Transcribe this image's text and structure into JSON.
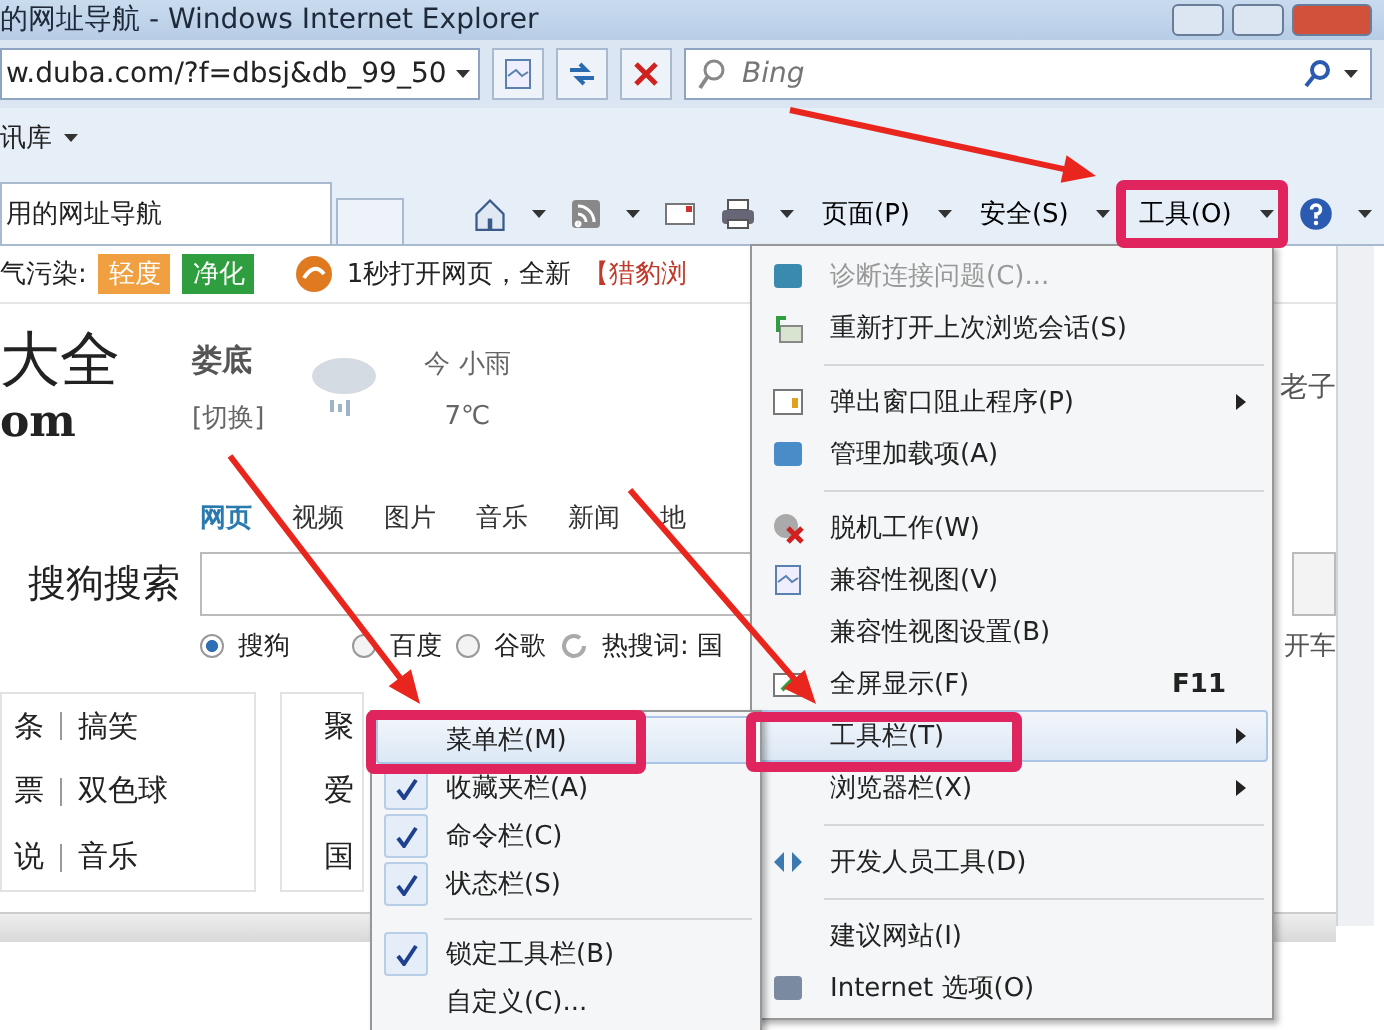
{
  "window": {
    "title": "的网址导航 - Windows Internet Explorer"
  },
  "address_bar": {
    "value": "w.duba.com/?f=dbsj&db_99_50"
  },
  "search_box": {
    "placeholder": "Bing"
  },
  "favorites_bar": {
    "label": "讯库"
  },
  "tab": {
    "label": "用的网址导航"
  },
  "command_bar": {
    "items": [
      {
        "kind": "home"
      },
      {
        "kind": "feed"
      },
      {
        "kind": "mail"
      },
      {
        "kind": "print"
      },
      {
        "kind": "text",
        "label": "页面(P)"
      },
      {
        "kind": "text",
        "label": "安全(S)"
      },
      {
        "kind": "text",
        "label": "工具(O)"
      },
      {
        "kind": "help"
      }
    ]
  },
  "page": {
    "notice": {
      "label": "气污染:",
      "badges": [
        {
          "label": "轻度",
          "color": "#f0a040"
        },
        {
          "label": "净化",
          "color": "#2e9e3e"
        }
      ],
      "promo": "1秒打开网页，全新",
      "promo_link": "【猎豹浏"
    },
    "logo": {
      "line1": "大全",
      "line2": "om"
    },
    "city": {
      "name": "娄底",
      "switch": "[切换]"
    },
    "weather": {
      "today": "今 小雨",
      "temp": "7℃"
    },
    "right_text": "老子",
    "search_tabs": [
      {
        "label": "网页",
        "selected": true
      },
      {
        "label": "视频",
        "selected": false
      },
      {
        "label": "图片",
        "selected": false
      },
      {
        "label": "音乐",
        "selected": false
      },
      {
        "label": "新闻",
        "selected": false
      },
      {
        "label": "地",
        "selected": false
      }
    ],
    "search_label": "搜狗搜索",
    "engines": [
      {
        "label": "搜狗",
        "selected": true
      },
      {
        "label": "百度",
        "selected": false
      },
      {
        "label": "谷歌",
        "selected": false
      }
    ],
    "hot_words": "热搜词: 国",
    "side_text": "开车",
    "links": [
      [
        "条",
        "搞笑"
      ],
      [
        "票",
        "双色球"
      ],
      [
        "说",
        "音乐"
      ]
    ],
    "middle": [
      "聚",
      "爱",
      "国"
    ]
  },
  "tools_menu": {
    "items": [
      {
        "kind": "item",
        "label": "诊断连接问题(C)...",
        "disabled": true
      },
      {
        "kind": "item",
        "label": "重新打开上次浏览会话(S)",
        "disabled": false
      },
      {
        "kind": "separator"
      },
      {
        "kind": "item",
        "label": "弹出窗口阻止程序(P)",
        "submenu": true,
        "disabled": false
      },
      {
        "kind": "item",
        "label": "管理加载项(A)",
        "disabled": false
      },
      {
        "kind": "separator"
      },
      {
        "kind": "item",
        "label": "脱机工作(W)",
        "disabled": false
      },
      {
        "kind": "item",
        "label": "兼容性视图(V)",
        "disabled": false
      },
      {
        "kind": "item",
        "label": "兼容性视图设置(B)",
        "disabled": false
      },
      {
        "kind": "item",
        "label": "全屏显示(F)",
        "shortcut": "F11",
        "disabled": false
      },
      {
        "kind": "item",
        "label": "工具栏(T)",
        "submenu": true,
        "selected": true,
        "disabled": false
      },
      {
        "kind": "item",
        "label": "浏览器栏(X)",
        "submenu": true,
        "disabled": false
      },
      {
        "kind": "separator"
      },
      {
        "kind": "item",
        "label": "开发人员工具(D)",
        "disabled": false
      },
      {
        "kind": "separator"
      },
      {
        "kind": "item",
        "label": "建议网站(I)",
        "disabled": false
      },
      {
        "kind": "item",
        "label": "Internet 选项(O)",
        "disabled": false
      }
    ]
  },
  "toolbars_menu": {
    "items": [
      {
        "kind": "item",
        "label": "菜单栏(M)",
        "checked": false,
        "selected": true
      },
      {
        "kind": "item",
        "label": "收藏夹栏(A)",
        "checked": true
      },
      {
        "kind": "item",
        "label": "命令栏(C)",
        "checked": true
      },
      {
        "kind": "item",
        "label": "状态栏(S)",
        "checked": true
      },
      {
        "kind": "separator"
      },
      {
        "kind": "item",
        "label": "锁定工具栏(B)",
        "checked": true
      },
      {
        "kind": "item",
        "label": "自定义(C)...",
        "checked": false
      }
    ]
  }
}
